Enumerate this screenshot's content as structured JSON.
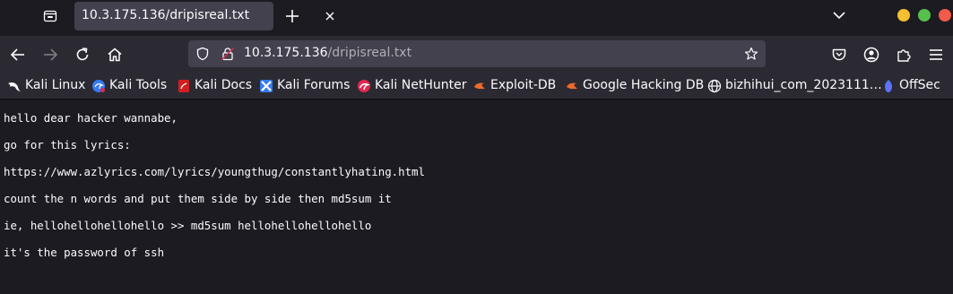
{
  "tab": {
    "title": "10.3.175.136/dripisreal.txt"
  },
  "urlbar": {
    "host": "10.3.175.136",
    "path": "/dripisreal.txt"
  },
  "bookmarks": [
    {
      "label": "Kali Linux",
      "icon": "kali-dragon-icon"
    },
    {
      "label": "Kali Tools",
      "icon": "kali-tools-icon"
    },
    {
      "label": "Kali Docs",
      "icon": "kali-docs-icon"
    },
    {
      "label": "Kali Forums",
      "icon": "kali-forums-icon"
    },
    {
      "label": "Kali NetHunter",
      "icon": "nethunter-icon"
    },
    {
      "label": "Exploit-DB",
      "icon": "exploit-db-icon"
    },
    {
      "label": "Google Hacking DB",
      "icon": "ghdb-icon"
    },
    {
      "label": "bizhihui_com_2023111…",
      "icon": "globe-icon"
    },
    {
      "label": "OffSec",
      "icon": "offsec-icon"
    }
  ],
  "page": {
    "lines": [
      "hello dear hacker wannabe,",
      "go for this lyrics:",
      "https://www.azlyrics.com/lyrics/youngthug/constantlyhating.html",
      "count the n words and put them side by side then md5sum it",
      "ie, hellohellohellohello >> md5sum hellohellohellohello",
      "it's the password of ssh"
    ]
  },
  "colors": {
    "chrome_bg": "#1c1b22",
    "toolbar_bg": "#2b2a33",
    "field_bg": "#42414d",
    "window_min": "#f4bf30",
    "window_max": "#55c14b",
    "window_close": "#f25a49"
  }
}
